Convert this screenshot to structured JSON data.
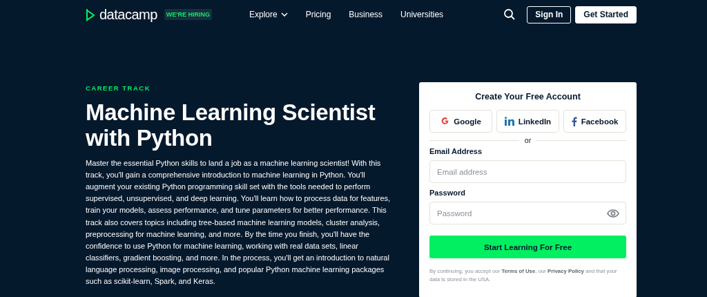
{
  "header": {
    "logo": "datacamp",
    "badge": "WE'RE HIRING",
    "nav": [
      {
        "label": "Explore",
        "dropdown": true
      },
      {
        "label": "Pricing",
        "dropdown": false
      },
      {
        "label": "Business",
        "dropdown": false
      },
      {
        "label": "Universities",
        "dropdown": false
      }
    ],
    "sign_in": "Sign In",
    "get_started": "Get Started"
  },
  "hero": {
    "eyebrow": "CAREER TRACK",
    "title": "Machine Learning Scientist with Python",
    "description": "Master the essential Python skills to land a job as a machine learning scientist! With this track, you'll gain a comprehensive introduction to machine learning in Python. You'll augment your existing Python programming skill set with the tools needed to perform supervised, unsupervised, and deep learning. You'll learn how to process data for features, train your models, assess performance, and tune parameters for better performance. This track also covers topics including tree-based machine learning models, cluster analysis, preprocessing for machine learning, and more. By the time you finish, you'll have the confidence to use Python for machine learning, working with real data sets, linear classifiers, gradient boosting, and more. In the process, you'll get an introduction to natural language processing, image processing, and popular Python machine learning packages such as scikit-learn, Spark, and Keras."
  },
  "signup": {
    "title": "Create Your Free Account",
    "social": [
      {
        "kind": "google",
        "label": "Google"
      },
      {
        "kind": "linkedin",
        "label": "LinkedIn"
      },
      {
        "kind": "facebook",
        "label": "Facebook"
      }
    ],
    "divider": "or",
    "fields": [
      {
        "kind": "email",
        "label": "Email Address",
        "placeholder": "Email address"
      },
      {
        "kind": "password",
        "label": "Password",
        "placeholder": "Password"
      }
    ],
    "submit": "Start Learning For Free",
    "legal": "By continuing, you accept our **Terms of Use**, our **Privacy Policy** and that your data is stored in the USA."
  }
}
